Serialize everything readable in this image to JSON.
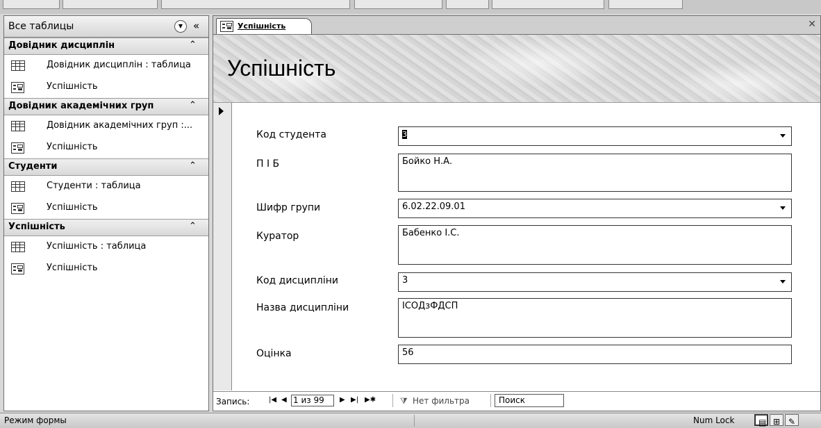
{
  "nav": {
    "header": "Все таблицы",
    "groups": [
      {
        "title": "Довідник дисциплін",
        "items": [
          {
            "label": "Довідник дисциплін : таблица",
            "icon": "table-icon"
          },
          {
            "label": "Успішність",
            "icon": "form-icon"
          }
        ]
      },
      {
        "title": "Довідник академічних груп",
        "items": [
          {
            "label": "Довідник академічних груп :...",
            "icon": "table-icon"
          },
          {
            "label": "Успішність",
            "icon": "form-icon"
          }
        ]
      },
      {
        "title": "Студенти",
        "items": [
          {
            "label": "Студенти : таблица",
            "icon": "table-icon"
          },
          {
            "label": "Успішність",
            "icon": "form-icon"
          }
        ]
      },
      {
        "title": "Успішність",
        "items": [
          {
            "label": "Успішність : таблица",
            "icon": "table-icon"
          },
          {
            "label": "Успішність",
            "icon": "form-icon"
          }
        ]
      }
    ]
  },
  "doc": {
    "tab_label": "Успішність",
    "form_title": "Успішність",
    "fields": {
      "student_code": {
        "label": "Код студента",
        "value": "3"
      },
      "pib": {
        "label": "П І Б",
        "value": "Бойко Н.А."
      },
      "group_code": {
        "label": "Шифр групи",
        "value": "6.02.22.09.01"
      },
      "curator": {
        "label": "Куратор",
        "value": "Бабенко І.С."
      },
      "discipline_code": {
        "label": "Код дисципліни",
        "value": "3"
      },
      "discipline_name": {
        "label": "Назва дисципліни",
        "value": "ІСОДзФДСП"
      },
      "grade": {
        "label": "Оцінка",
        "value": "56"
      }
    }
  },
  "recnav": {
    "label": "Запись:",
    "position": "1 из 99",
    "filter": "Нет фильтра",
    "search": "Поиск"
  },
  "status": {
    "mode": "Режим формы",
    "numlock": "Num Lock"
  }
}
